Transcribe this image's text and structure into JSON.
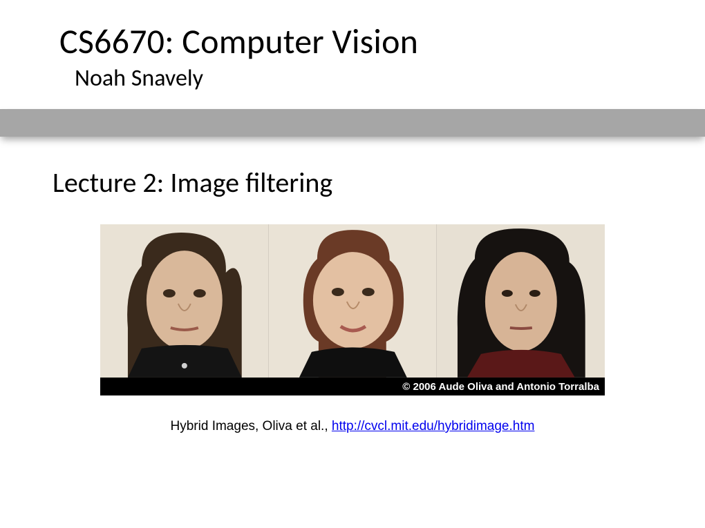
{
  "header": {
    "title": "CS6670: Computer Vision",
    "author": "Noah Snavely"
  },
  "lecture": {
    "title": "Lecture 2: Image filtering"
  },
  "figure": {
    "copyright": "© 2006 Aude Oliva and Antonio Torralba",
    "caption_prefix": "Hybrid Images, Oliva et al., ",
    "caption_link_text": "http://cvcl.mit.edu/hybridimage.htm",
    "caption_link_href": "http://cvcl.mit.edu/hybridimage.htm"
  }
}
